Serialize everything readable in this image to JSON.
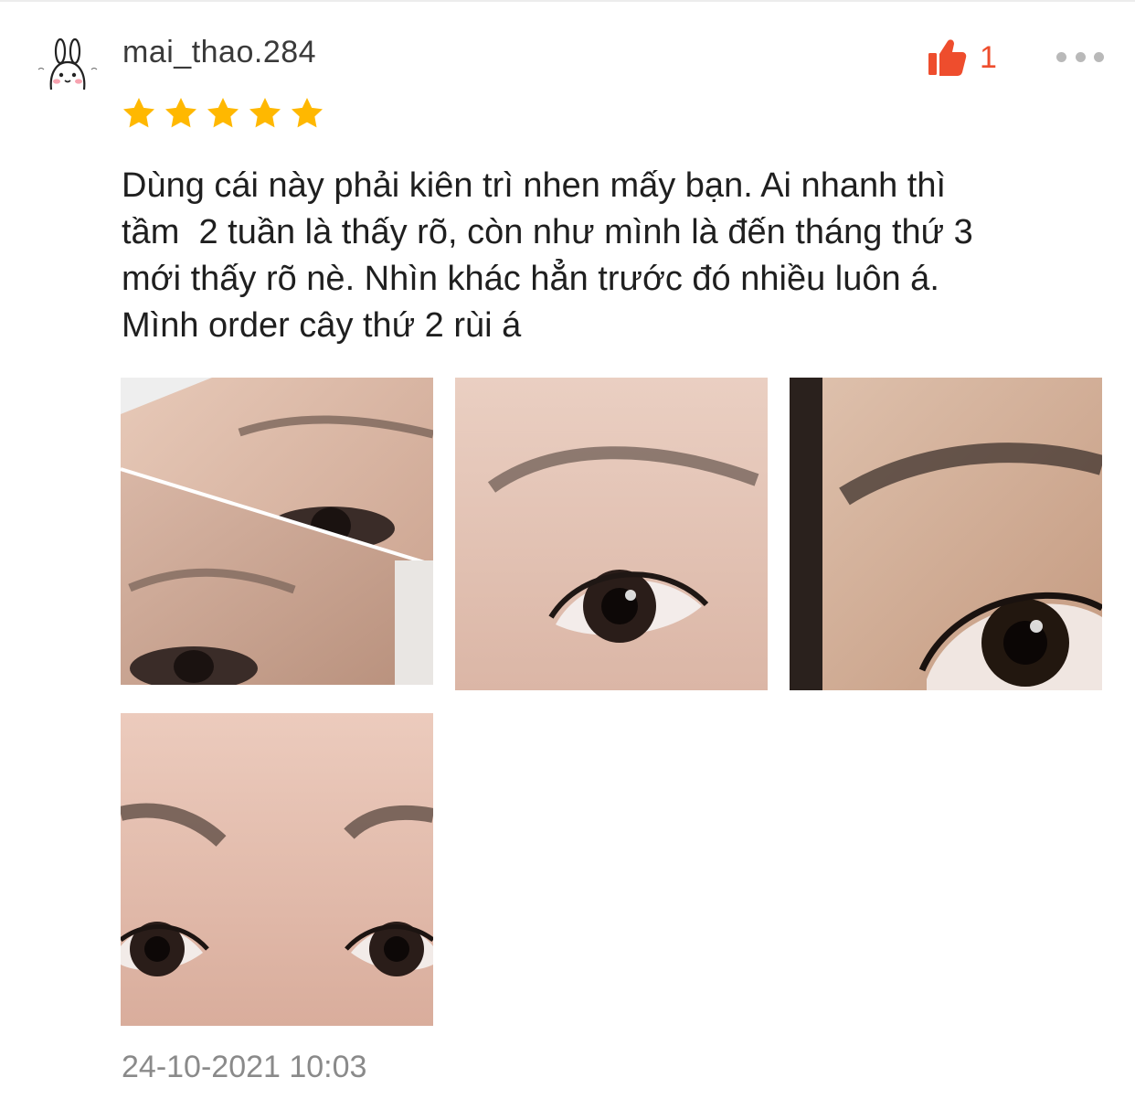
{
  "review": {
    "username": "mai_thao.284",
    "avatar_icon": "bunny-avatar-icon",
    "like_icon": "thumbs-up-icon",
    "like_count": "1",
    "like_color": "#ee4d2d",
    "more_icon": "more-dots-icon",
    "rating": 5,
    "rating_max": 5,
    "star_color": "#ffb800",
    "text": "Dùng cái này phải kiên trì nhen mấy bạn. Ai nhanh thì\ntầm  2 tuần là thấy rõ, còn như mình là đến tháng thứ 3\nmới thấy rõ nè. Nhìn khác hẳn trước đó nhiều luôn á.\nMình order cây thứ 2 rùi á",
    "photos_count": 4,
    "timestamp": "24-10-2021 10:03"
  }
}
